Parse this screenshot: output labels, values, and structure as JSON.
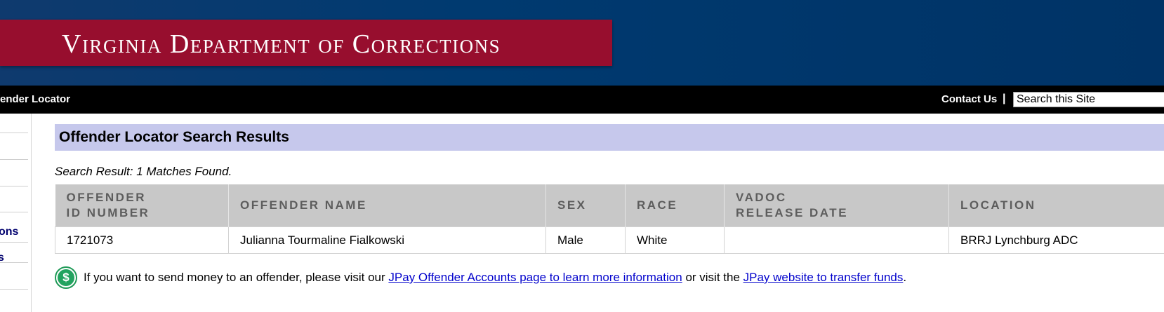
{
  "header": {
    "title": "Virginia Department of Corrections",
    "colors": {
      "banner": "#970e2e",
      "background": "#003a70"
    }
  },
  "navbar": {
    "left_label": "ffender Locator",
    "contact_label": "Contact Us",
    "separator": "|",
    "search_placeholder": "Search this Site"
  },
  "sidebar": {
    "link_fragment_1": "ons",
    "link_fragment_2": "s"
  },
  "main": {
    "section_title": "Offender Locator Search Results",
    "result_count": "Search Result: 1 Matches Found.",
    "table": {
      "headers": [
        "OFFENDER\nID NUMBER",
        "OFFENDER NAME",
        "SEX",
        "RACE",
        "VADOC\nRELEASE DATE",
        "LOCATION"
      ],
      "rows": [
        [
          "1721073",
          "Julianna Tourmaline Fialkowski",
          "Male",
          "White",
          "",
          "BRRJ Lynchburg ADC"
        ]
      ]
    },
    "notice": {
      "icon": "dollar-icon",
      "text_before": "If you want to send money to an offender, please visit our ",
      "link1": "JPay Offender Accounts page to learn more information",
      "text_middle": " or visit the ",
      "link2": "JPay website to transfer funds",
      "text_after": "."
    }
  }
}
